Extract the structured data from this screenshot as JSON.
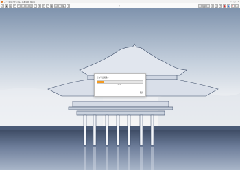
{
  "window": {
    "title": "一二三四五六七八九十 · 场景示例 · 导出中",
    "controls": [
      "–",
      "□",
      "✕"
    ]
  },
  "toolbar": {
    "left_icons": [
      "home-icon",
      "folder-icon",
      "save-icon",
      "undo-icon",
      "redo-icon",
      "cut-icon",
      "copy-icon",
      "paste-icon",
      "select-icon",
      "move-icon",
      "rotate-icon",
      "scale-icon",
      "grid-icon",
      "camera-icon",
      "light-icon",
      "render-icon",
      "export-icon"
    ],
    "left_glyphs": [
      "⌂",
      "▣",
      "▤",
      "↶",
      "↷",
      "✂",
      "⧉",
      "▥",
      "▢",
      "✥",
      "⟳",
      "⤢",
      "▦",
      "◉",
      "☀",
      "▶",
      "⇪"
    ],
    "center_glyph": "▾",
    "right_icons": [
      "layout-icon",
      "view-icon",
      "list-icon",
      "settings-icon",
      "link-icon",
      "refresh-icon",
      "record-icon",
      "user-icon",
      "help-icon",
      "menu-icon"
    ],
    "right_glyphs": [
      "▭",
      "▦",
      "☰",
      "⚙",
      "⛓",
      "⟲",
      "●",
      "◉",
      "?",
      "≡"
    ]
  },
  "dialog": {
    "title": "正在导出图像...",
    "progress_percent": 15,
    "progress_text": "15%",
    "cancel_label": "取消"
  },
  "colors": {
    "progress_fill": "#f39a1f",
    "sky_top": "#7f93ad",
    "sky_horizon": "#f2f3f5",
    "water": "#5a6a88"
  }
}
